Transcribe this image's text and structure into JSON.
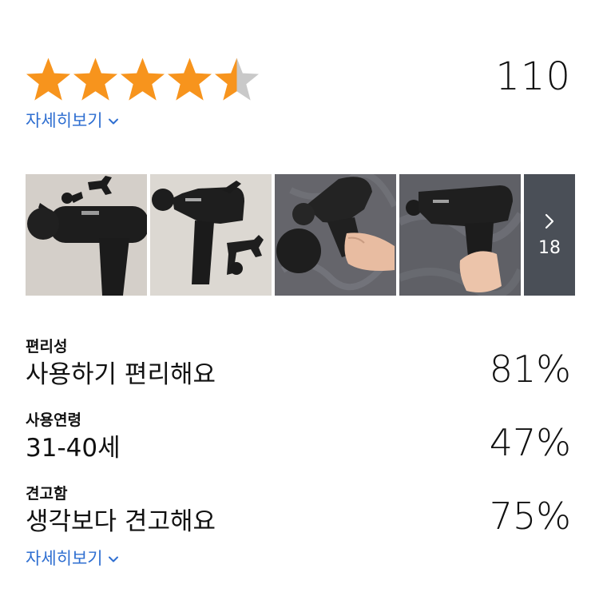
{
  "rating": {
    "stars": [
      1,
      1,
      1,
      1,
      0.5
    ],
    "count": "110",
    "star_color": "#f7941d",
    "star_empty_color": "#c9c9c9"
  },
  "detail_link_top": "자세히보기",
  "gallery": {
    "thumbnails": [
      "photo-1",
      "photo-2",
      "photo-3",
      "photo-4"
    ],
    "more_count": "18"
  },
  "attributes": [
    {
      "label": "편리성",
      "value": "사용하기 편리해요",
      "percent": "81%"
    },
    {
      "label": "사용연령",
      "value": "31-40세",
      "percent": "47%"
    },
    {
      "label": "견고함",
      "value": "생각보다 견고해요",
      "percent": "75%"
    }
  ],
  "detail_link_bottom": "자세히보기",
  "colors": {
    "link": "#2f6fd1",
    "tile_bg": "#4a4f57"
  }
}
